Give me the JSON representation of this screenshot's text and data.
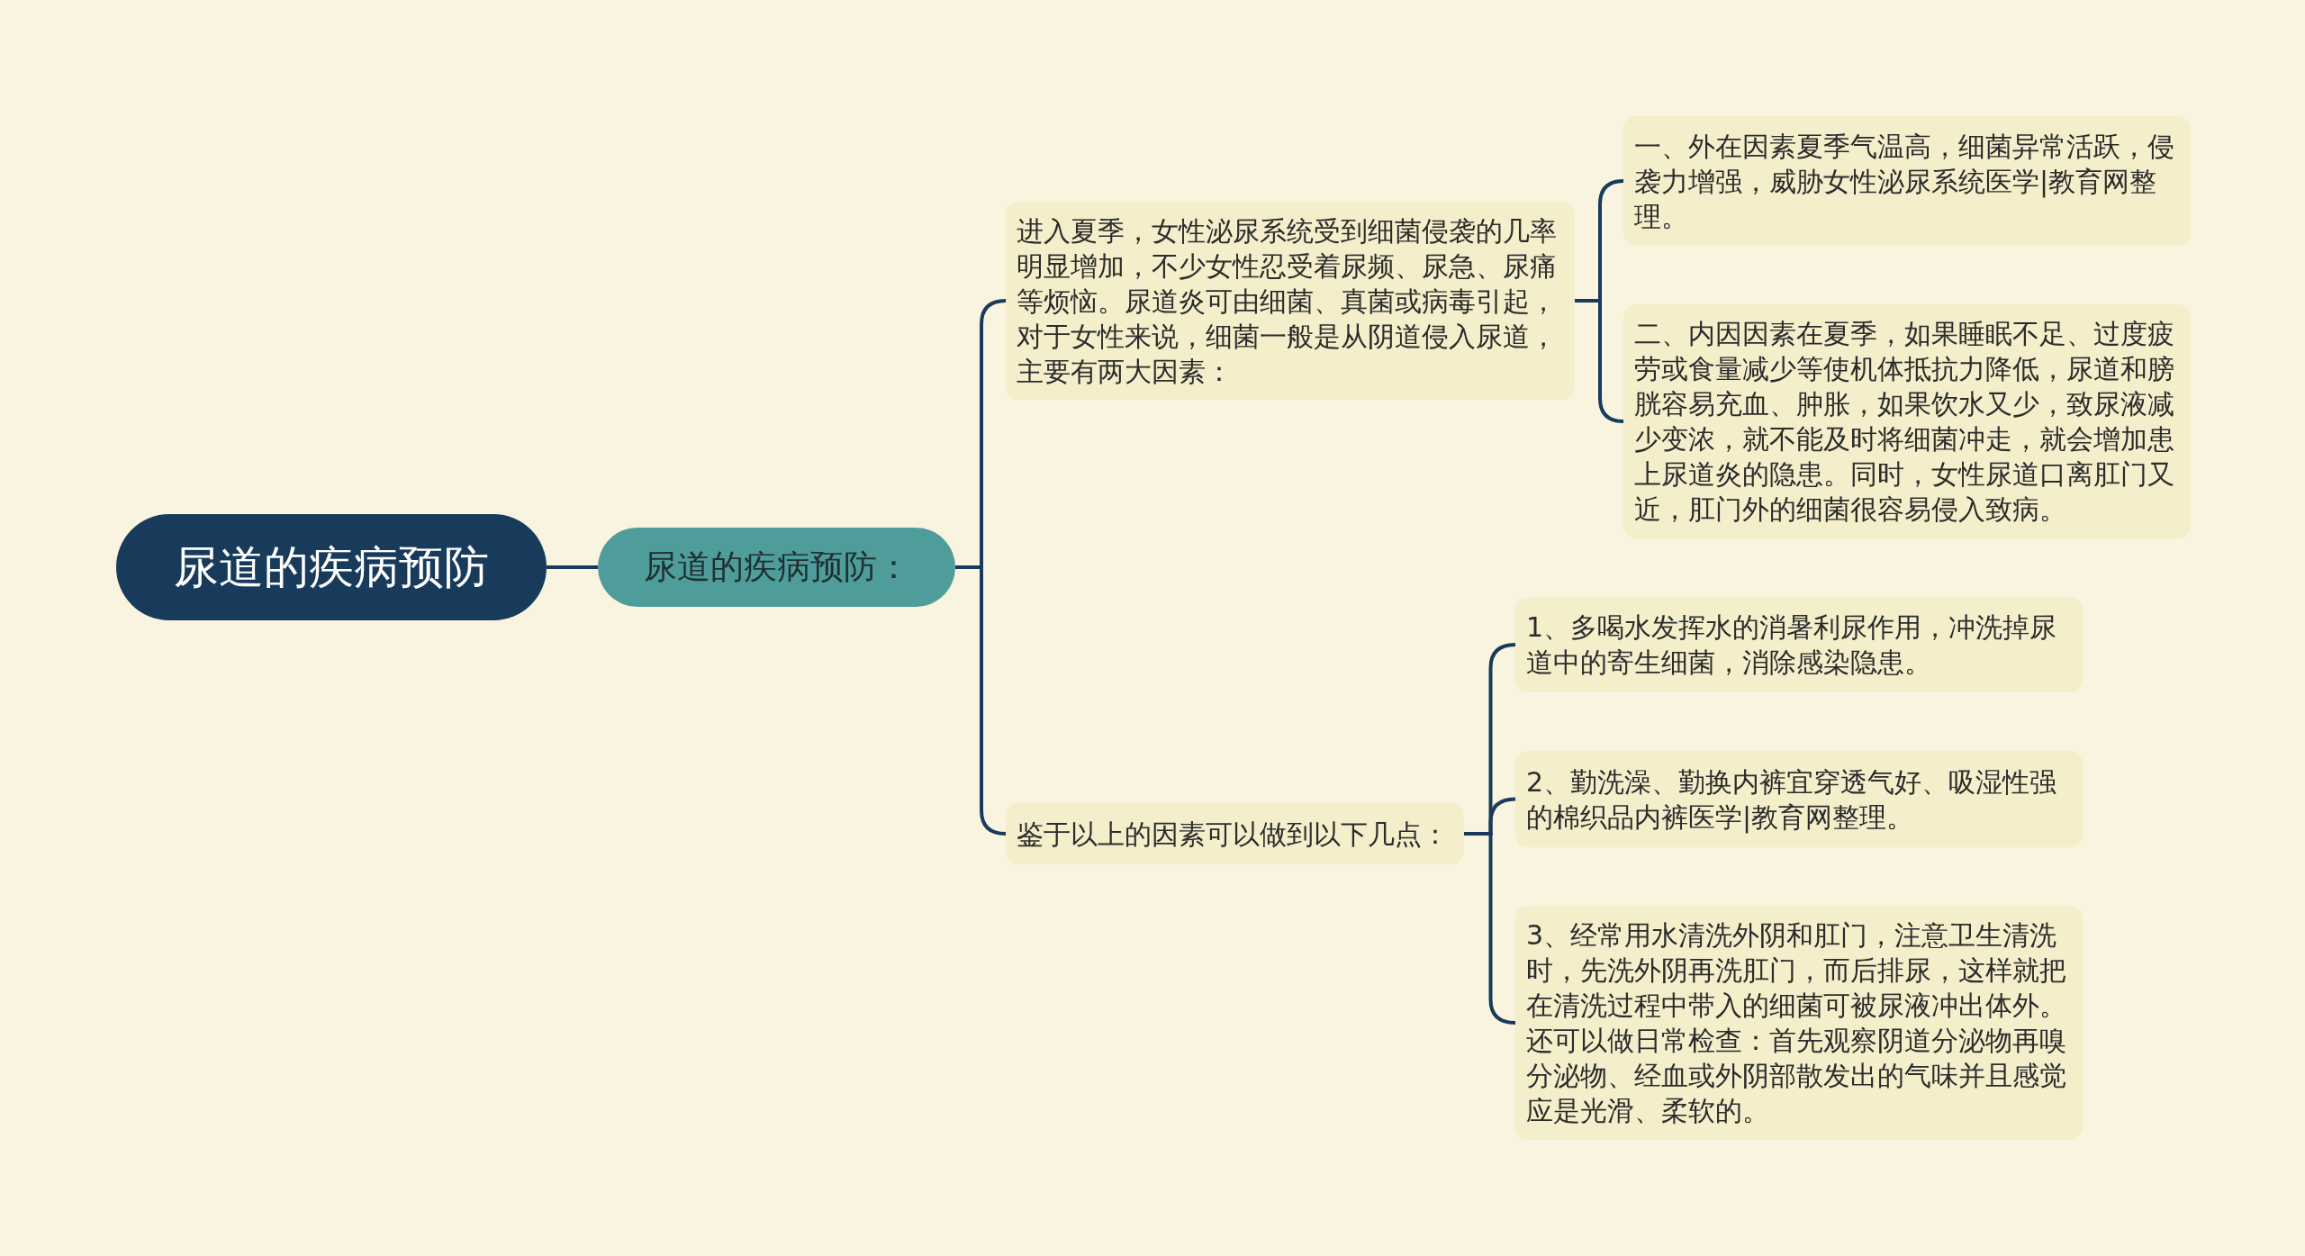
{
  "mind_map": {
    "title": "尿道的疾病预防",
    "children": [
      {
        "title": "尿道的疾病预防：",
        "children": [
          {
            "title": "进入夏季，女性泌尿系统受到细菌侵袭的几率明显增加，不少女性忍受着尿频、尿急、尿痛等烦恼。尿道炎可由细菌、真菌或病毒引起，对于女性来说，细菌一般是从阴道侵入尿道，主要有两大因素：",
            "children": [
              {
                "title": "一、外在因素夏季气温高，细菌异常活跃，侵袭力增强，威胁女性泌尿系统医学|教育网整理。"
              },
              {
                "title": "二、内因因素在夏季，如果睡眠不足、过度疲劳或食量减少等使机体抵抗力降低，尿道和膀胱容易充血、肿胀，如果饮水又少，致尿液减少变浓，就不能及时将细菌冲走，就会增加患上尿道炎的隐患。同时，女性尿道口离肛门又近，肛门外的细菌很容易侵入致病。"
              }
            ]
          },
          {
            "title": "鉴于以上的因素可以做到以下几点：",
            "children": [
              {
                "title": "1、多喝水发挥水的消暑利尿作用，冲洗掉尿道中的寄生细菌，消除感染隐患。"
              },
              {
                "title": "2、勤洗澡、勤换内裤宜穿透气好、吸湿性强的棉织品内裤医学|教育网整理。"
              },
              {
                "title": "3、经常用水清洗外阴和肛门，注意卫生清洗时，先洗外阴再洗肛门，而后排尿，这样就把在清洗过程中带入的细菌可被尿液冲出体外。还可以做日常检查：首先观察阴道分泌物再嗅分泌物、经血或外阴部散发出的气味并且感觉应是光滑、柔软的。"
              }
            ]
          }
        ]
      }
    ]
  }
}
